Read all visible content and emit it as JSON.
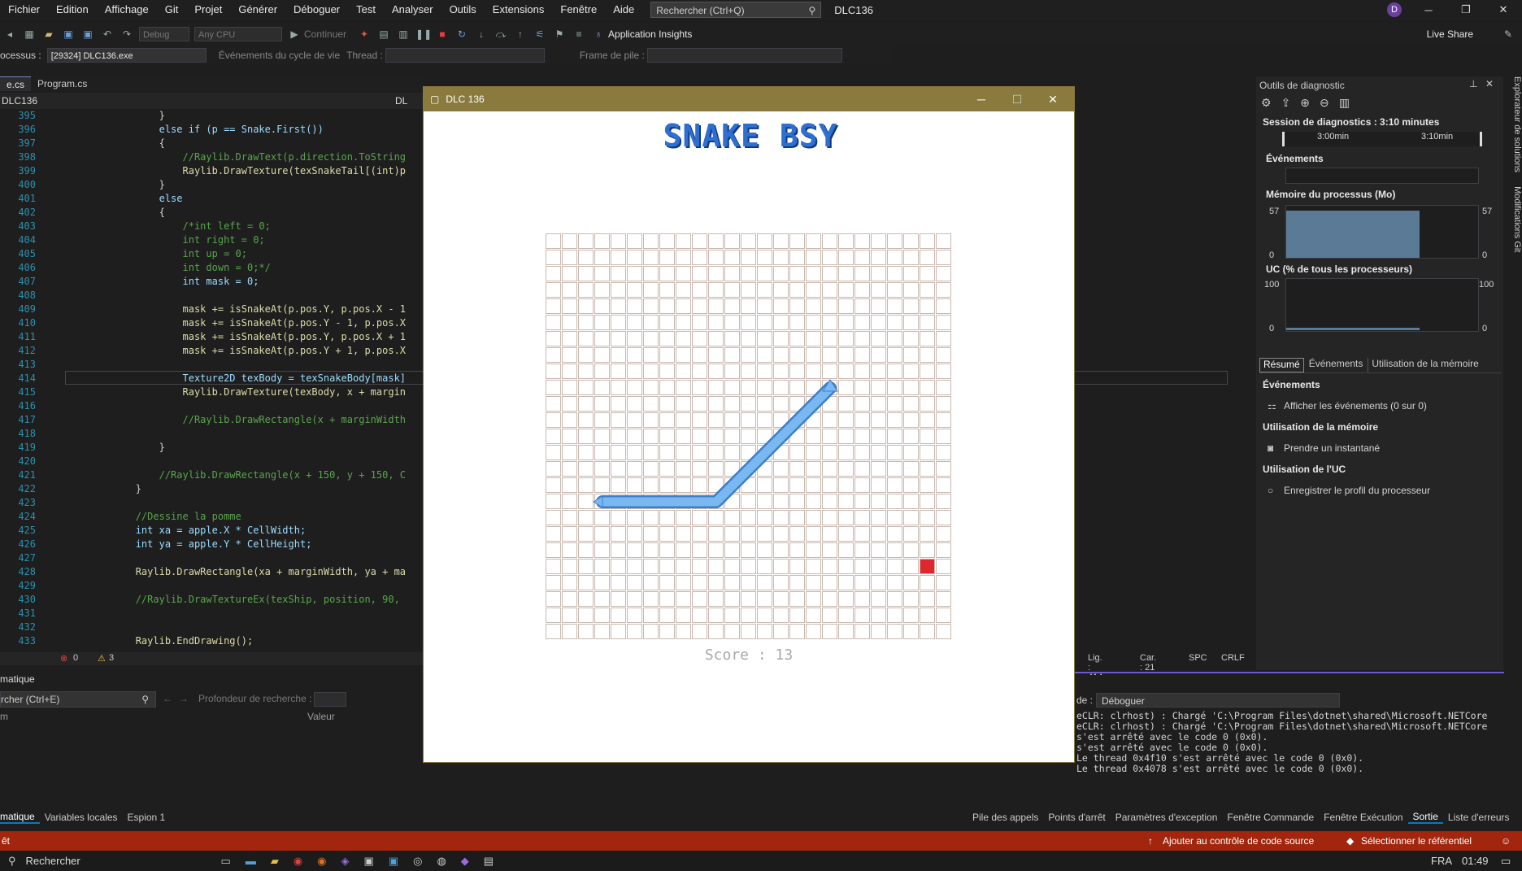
{
  "menubar": {
    "items": [
      "Fichier",
      "Edition",
      "Affichage",
      "Git",
      "Projet",
      "Générer",
      "Déboguer",
      "Test",
      "Analyser",
      "Outils",
      "Extensions",
      "Fenêtre",
      "Aide"
    ],
    "search_placeholder": "Rechercher (Ctrl+Q)",
    "solution_name": "DLC136",
    "avatar_letter": "D"
  },
  "toolbar": {
    "config": "Debug",
    "platform": "Any CPU",
    "continue_label": "Continuer",
    "app_insights": "Application Insights",
    "live_share": "Live Share",
    "process_label": "ocessus :",
    "process_value": "[29324] DLC136.exe",
    "lifecycle_label": "Événements du cycle de vie",
    "thread_label": "Thread :",
    "stack_label": "Frame de pile :"
  },
  "editor": {
    "tabs": [
      "e.cs",
      "Program.cs"
    ],
    "nav_left": "DLC136",
    "nav_right": "DL",
    "lines": [
      {
        "n": "395",
        "code": "                }"
      },
      {
        "n": "396",
        "code": "                else if (p == Snake.First())"
      },
      {
        "n": "397",
        "code": "                {"
      },
      {
        "n": "398",
        "code": "                    //Raylib.DrawText(p.direction.ToString"
      },
      {
        "n": "399",
        "code": "                    Raylib.DrawTexture(texSnakeTail[(int)p"
      },
      {
        "n": "400",
        "code": "                }"
      },
      {
        "n": "401",
        "code": "                else"
      },
      {
        "n": "402",
        "code": "                {"
      },
      {
        "n": "403",
        "code": "                    /*int left = 0;"
      },
      {
        "n": "404",
        "code": "                    int right = 0;"
      },
      {
        "n": "405",
        "code": "                    int up = 0;"
      },
      {
        "n": "406",
        "code": "                    int down = 0;*/"
      },
      {
        "n": "407",
        "code": "                    int mask = 0;"
      },
      {
        "n": "408",
        "code": ""
      },
      {
        "n": "409",
        "code": "                    mask += isSnakeAt(p.pos.Y, p.pos.X - 1"
      },
      {
        "n": "410",
        "code": "                    mask += isSnakeAt(p.pos.Y - 1, p.pos.X"
      },
      {
        "n": "411",
        "code": "                    mask += isSnakeAt(p.pos.Y, p.pos.X + 1"
      },
      {
        "n": "412",
        "code": "                    mask += isSnakeAt(p.pos.Y + 1, p.pos.X"
      },
      {
        "n": "413",
        "code": ""
      },
      {
        "n": "414",
        "code": "                    Texture2D texBody = texSnakeBody[mask]"
      },
      {
        "n": "415",
        "code": "                    Raylib.DrawTexture(texBody, x + margin"
      },
      {
        "n": "416",
        "code": ""
      },
      {
        "n": "417",
        "code": "                    //Raylib.DrawRectangle(x + marginWidth"
      },
      {
        "n": "418",
        "code": ""
      },
      {
        "n": "419",
        "code": "                }"
      },
      {
        "n": "420",
        "code": ""
      },
      {
        "n": "421",
        "code": "                //Raylib.DrawRectangle(x + 150, y + 150, C"
      },
      {
        "n": "422",
        "code": "            }"
      },
      {
        "n": "423",
        "code": ""
      },
      {
        "n": "424",
        "code": "            //Dessine la pomme"
      },
      {
        "n": "425",
        "code": "            int xa = apple.X * CellWidth;"
      },
      {
        "n": "426",
        "code": "            int ya = apple.Y * CellHeight;"
      },
      {
        "n": "427",
        "code": ""
      },
      {
        "n": "428",
        "code": "            Raylib.DrawRectangle(xa + marginWidth, ya + ma"
      },
      {
        "n": "429",
        "code": ""
      },
      {
        "n": "430",
        "code": "            //Raylib.DrawTextureEx(texShip, position, 90,"
      },
      {
        "n": "431",
        "code": ""
      },
      {
        "n": "432",
        "code": ""
      },
      {
        "n": "433",
        "code": "            Raylib.EndDrawing();"
      }
    ],
    "errors": "0",
    "warnings": "3",
    "line_info": "Lig. : 414",
    "col_info": "Car. : 21",
    "spc": "SPC",
    "crlf": "CRLF"
  },
  "bottom_left": {
    "title": "matique",
    "search_placeholder": "rcher (Ctrl+E)",
    "depth_label": "Profondeur de recherche :",
    "col_name": "m",
    "col_value": "Valeur",
    "tabs": [
      "matique",
      "Variables locales",
      "Espion 1"
    ]
  },
  "diagnostics": {
    "title": "Outils de diagnostic",
    "session": "Session de diagnostics : 3:10 minutes",
    "time1": "3:00min",
    "time2": "3:10min",
    "events_header": "Événements",
    "memory_header": "Mémoire du processus (Mo)",
    "mem_max": "57",
    "mem_min": "0",
    "cpu_header": "UC (% de tous les processeurs)",
    "cpu_max": "100",
    "cpu_min": "0",
    "tabs": [
      "Résumé",
      "Événements",
      "Utilisation de la mémoire"
    ],
    "sec_events": "Événements",
    "show_events": "Afficher les événements (0 sur 0)",
    "sec_memory": "Utilisation de la mémoire",
    "take_snapshot": "Prendre un instantané",
    "sec_cpu": "Utilisation de l'UC",
    "record_cpu": "Enregistrer le profil du processeur",
    "side_tab1": "Explorateur de solutions",
    "side_tab2": "Modifications Git"
  },
  "output": {
    "source_label": "de :",
    "source_value": "Déboguer",
    "lines": [
      "eCLR: clrhost) : Chargé 'C:\\Program Files\\dotnet\\shared\\Microsoft.NETCore",
      "eCLR: clrhost) : Chargé 'C:\\Program Files\\dotnet\\shared\\Microsoft.NETCore",
      "s'est arrêté avec le code 0 (0x0).",
      "s'est arrêté avec le code 0 (0x0).",
      "Le thread 0x4f10 s'est arrêté avec le code 0 (0x0).",
      "Le thread 0x4078 s'est arrêté avec le code 0 (0x0)."
    ],
    "tabs": [
      "Pile des appels",
      "Points d'arrêt",
      "Paramètres d'exception",
      "Fenêtre Commande",
      "Fenêtre Exécution",
      "Sortie",
      "Liste d'erreurs"
    ]
  },
  "statusbar": {
    "left": "êt",
    "source_control": "Ajouter au contrôle de code source",
    "repo": "Sélectionner le référentiel"
  },
  "taskbar": {
    "search": "Rechercher",
    "lang": "FRA",
    "time": "01:49"
  },
  "game": {
    "window_title": "DLC 136",
    "title": "SNAKE BSY",
    "score": "Score : 13",
    "grid_cols": 25,
    "grid_rows": 25,
    "snake_cells": [
      [
        3,
        16
      ],
      [
        4,
        16
      ],
      [
        5,
        16
      ],
      [
        6,
        16
      ],
      [
        7,
        16
      ],
      [
        8,
        16
      ],
      [
        9,
        16
      ],
      [
        10,
        16
      ],
      [
        11,
        15
      ],
      [
        12,
        14
      ],
      [
        13,
        13
      ],
      [
        14,
        12
      ],
      [
        15,
        11
      ],
      [
        16,
        10
      ],
      [
        17,
        9
      ]
    ],
    "apple_cell": [
      23,
      20
    ],
    "colors": {
      "snake": "#79b8f0",
      "snake_edge": "#3c7fc7",
      "apple": "#e0262f",
      "grid": "#c9b8b0",
      "title_bar": "#8a7a3e"
    }
  }
}
